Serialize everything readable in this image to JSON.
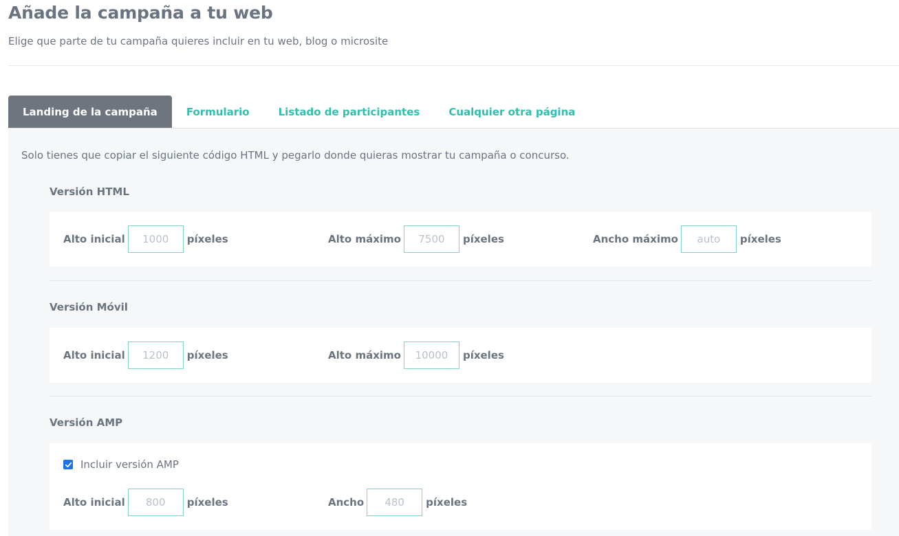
{
  "header": {
    "title": "Añade la campaña a tu web",
    "subtitle": "Elige que parte de tu campaña quieres incluir en tu web, blog o microsite"
  },
  "tabs": [
    {
      "label": "Landing de la campaña",
      "active": true
    },
    {
      "label": "Formulario",
      "active": false
    },
    {
      "label": "Listado de participantes",
      "active": false
    },
    {
      "label": "Cualquier otra página",
      "active": false
    }
  ],
  "intro": "Solo tienes que copiar el siguiente código HTML y pegarlo donde quieras mostrar tu campaña o concurso.",
  "units": "píxeles",
  "html_version": {
    "title": "Versión HTML",
    "fields": [
      {
        "label": "Alto inicial",
        "placeholder": "1000",
        "value": ""
      },
      {
        "label": "Alto máximo",
        "placeholder": "7500",
        "value": ""
      },
      {
        "label": "Ancho máximo",
        "placeholder": "auto",
        "value": ""
      }
    ]
  },
  "mobile_version": {
    "title": "Versión Móvil",
    "fields": [
      {
        "label": "Alto inicial",
        "placeholder": "1200",
        "value": ""
      },
      {
        "label": "Alto máximo",
        "placeholder": "10000",
        "value": ""
      }
    ]
  },
  "amp_version": {
    "title": "Versión AMP",
    "checkbox_label": "Incluir versión AMP",
    "checkbox_checked": true,
    "fields": [
      {
        "label": "Alto inicial",
        "placeholder": "800",
        "value": ""
      },
      {
        "label": "Ancho",
        "placeholder": "480",
        "value": ""
      }
    ]
  },
  "colors": {
    "accent": "#2fbfae",
    "active_tab": "#6e757e",
    "checkbox": "#1a73e8"
  }
}
